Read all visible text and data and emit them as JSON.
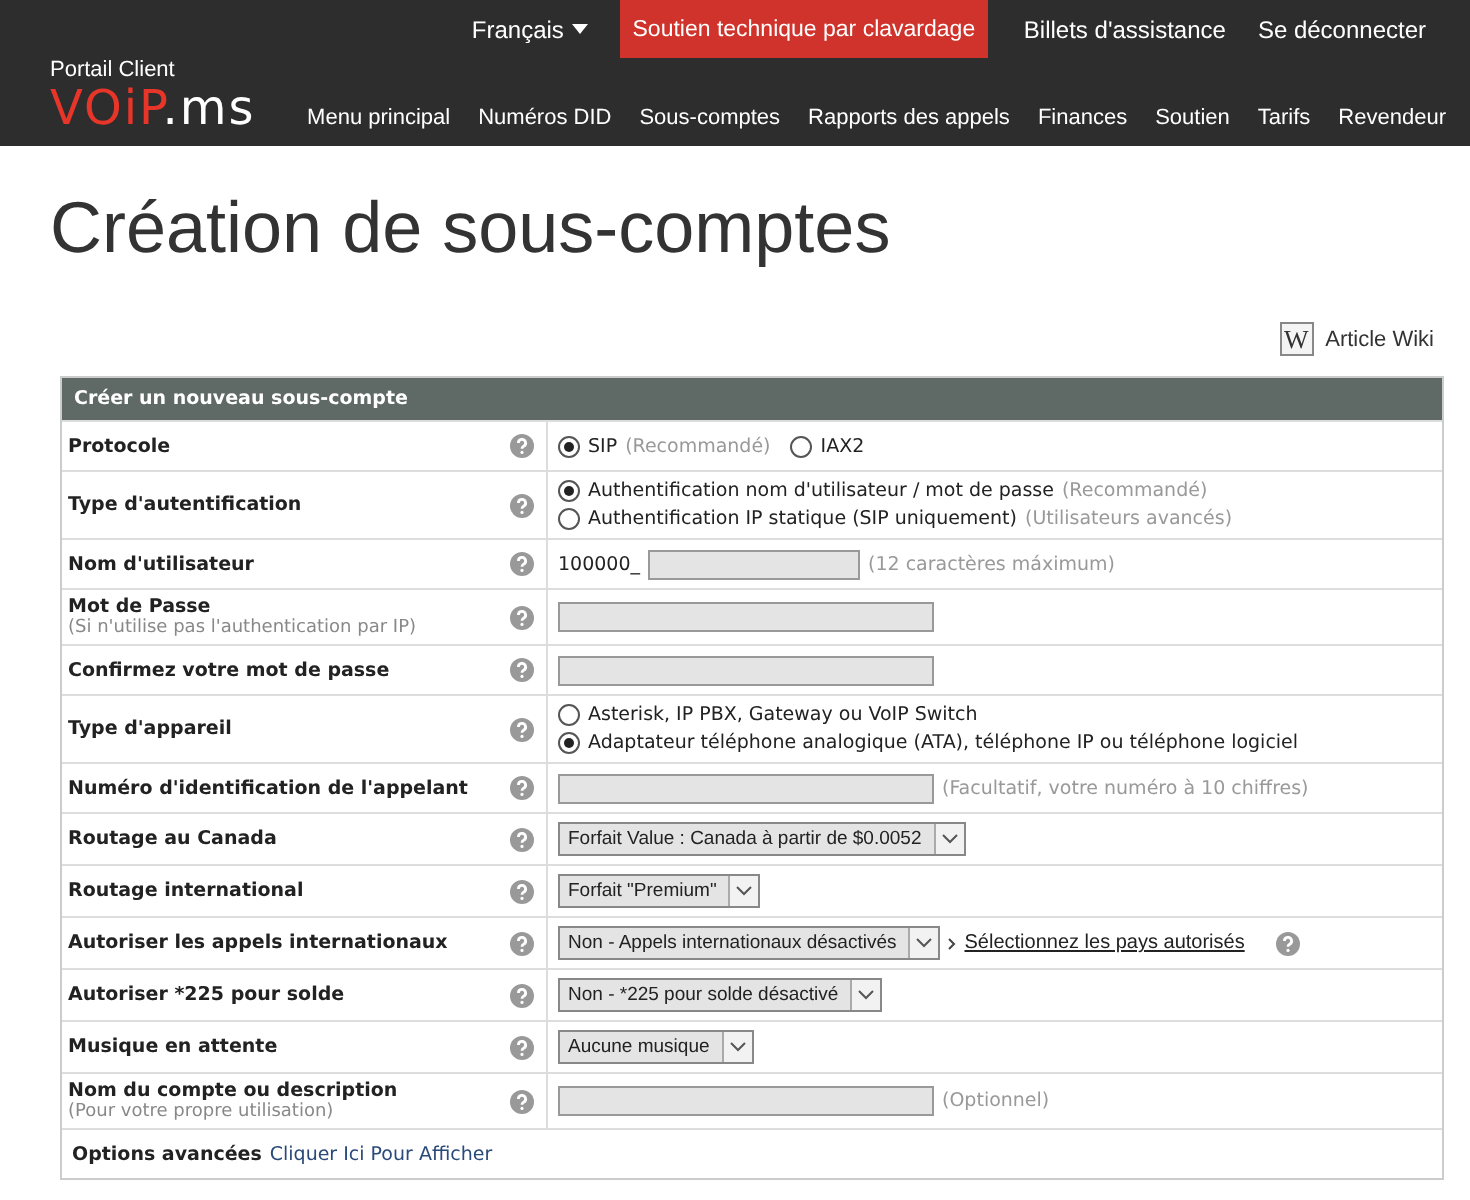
{
  "header": {
    "language": "Français",
    "chat_button": "Soutien technique par clavardage",
    "top_links": [
      "Billets d'assistance",
      "Se déconnecter"
    ],
    "logo_caption": "Portail Client",
    "logo_main": "VOiP",
    "logo_suffix": ".ms",
    "nav": [
      "Menu principal",
      "Numéros DID",
      "Sous-comptes",
      "Rapports des appels",
      "Finances",
      "Soutien",
      "Tarifs",
      "Revendeur"
    ]
  },
  "page_title": "Création de sous-comptes",
  "wiki_link": {
    "icon_letter": "W",
    "label": "Article Wiki"
  },
  "form": {
    "title": "Créer un nouveau sous-compte",
    "rows": [
      {
        "kind": "radio-row",
        "label": "Protocole",
        "options": [
          {
            "label": "SIP",
            "note": "(Recommandé)",
            "selected": true
          },
          {
            "label": "IAX2",
            "selected": false
          }
        ]
      },
      {
        "kind": "radio-list",
        "label": "Type d'autentification",
        "options": [
          {
            "label": "Authentification nom d'utilisateur / mot de passe",
            "note": "(Recommandé)",
            "selected": true
          },
          {
            "label": "Authentification IP statique (SIP uniquement)",
            "note": "(Utilisateurs avancés)",
            "selected": false
          }
        ]
      },
      {
        "kind": "input",
        "label": "Nom d'utilisateur",
        "prefix": "100000_",
        "note": "(12 caractères máximum)"
      },
      {
        "kind": "input",
        "label": "Mot de Passe",
        "sublabel": "(Si n'utilise pas l'authentication par IP)"
      },
      {
        "kind": "input",
        "label": "Confirmez votre mot de passe"
      },
      {
        "kind": "radio-list",
        "label": "Type d'appareil",
        "options": [
          {
            "label": "Asterisk, IP PBX, Gateway ou VoIP Switch",
            "selected": false
          },
          {
            "label": "Adaptateur téléphone analogique (ATA), téléphone IP ou téléphone logiciel",
            "selected": true
          }
        ]
      },
      {
        "kind": "input",
        "label": "Numéro d'identification de l'appelant",
        "note": "(Facultatif, votre numéro à 10 chiffres)"
      },
      {
        "kind": "select",
        "label": "Routage au Canada",
        "value": "Forfait Value : Canada à partir de $0.0052"
      },
      {
        "kind": "select",
        "label": "Routage international",
        "value": "Forfait \"Premium\""
      },
      {
        "kind": "select",
        "label": "Autoriser les appels internationaux",
        "value": "Non - Appels internationaux désactivés",
        "link": "Sélectionnez les pays autorisés"
      },
      {
        "kind": "select",
        "label": "Autoriser *225 pour solde",
        "value": "Non - *225 pour solde désactivé"
      },
      {
        "kind": "select",
        "label": "Musique en attente",
        "value": "Aucune musique"
      },
      {
        "kind": "input",
        "label": "Nom du compte ou description",
        "sublabel": "(Pour votre propre utilisation)",
        "note": "(Optionnel)"
      }
    ],
    "footer": {
      "label": "Options avancées",
      "link": "Cliquer Ici Pour Afficher"
    }
  }
}
